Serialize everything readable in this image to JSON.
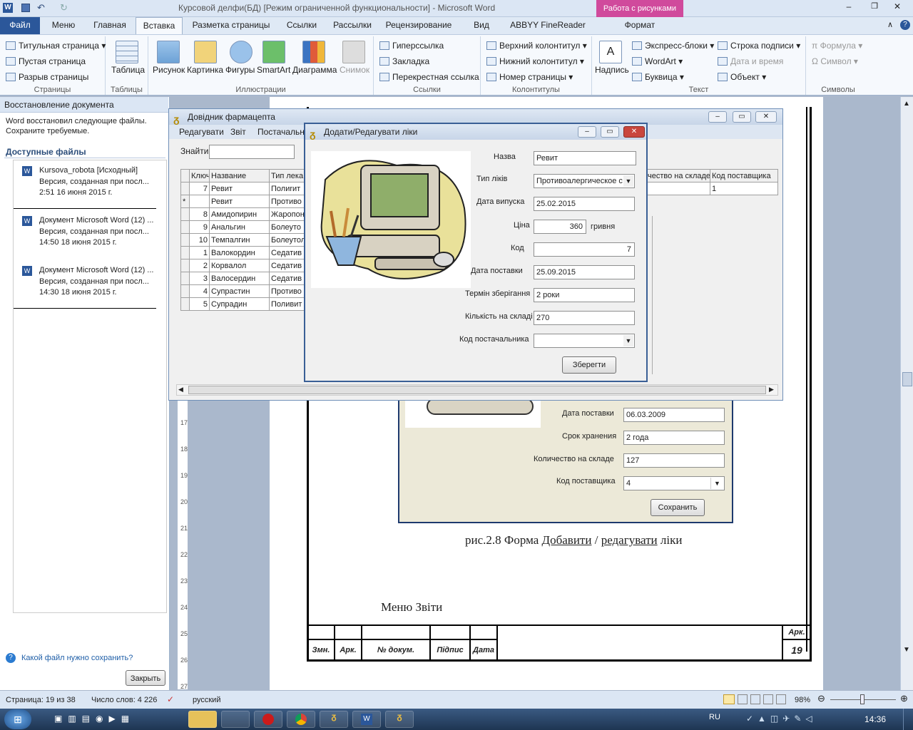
{
  "window": {
    "title": "Курсовой делфи(БД) [Режим ограниченной функциональности] - Microsoft Word",
    "tools_tab": "Работа с рисунками"
  },
  "tabs": [
    "Файл",
    "Меню",
    "Главная",
    "Вставка",
    "Разметка страницы",
    "Ссылки",
    "Рассылки",
    "Рецензирование",
    "Вид",
    "ABBYY FineReader 11",
    "Формат"
  ],
  "ribbon": {
    "pages": {
      "items": [
        "Титульная страница",
        "Пустая страница",
        "Разрыв страницы"
      ],
      "label": "Страницы"
    },
    "tables": {
      "items": [
        "Таблица"
      ],
      "label": "Таблицы"
    },
    "illustrations": {
      "items": [
        "Рисунок",
        "Картинка",
        "Фигуры",
        "SmartArt",
        "Диаграмма",
        "Снимок"
      ],
      "label": "Иллюстрации"
    },
    "links": {
      "items": [
        "Гиперссылка",
        "Закладка",
        "Перекрестная ссылка"
      ],
      "label": "Ссылки"
    },
    "headers": {
      "items": [
        "Верхний колонтитул",
        "Нижний колонтитул",
        "Номер страницы"
      ],
      "label": "Колонтитулы"
    },
    "text": {
      "items": [
        "Надпись",
        "Экспресс-блоки",
        "WordArt",
        "Буквица",
        "Строка подписи",
        "Дата и время",
        "Объект"
      ],
      "label": "Текст"
    },
    "symbols": {
      "items": [
        "Формула",
        "Символ"
      ],
      "label": "Символы"
    }
  },
  "recovery": {
    "header": "Восстановление документа",
    "desc1": "Word восстановил следующие файлы.",
    "desc2": "Сохраните требуемые.",
    "available": "Доступные файлы",
    "files": [
      {
        "name": "Kursova_robota  [Исходный]",
        "desc": "Версия, созданная при посл...",
        "time": "2:51 16 июня 2015 г."
      },
      {
        "name": "Документ Microsoft Word (12) ...",
        "desc": "Версия, созданная при посл...",
        "time": "14:50 18 июня 2015 г."
      },
      {
        "name": "Документ Microsoft Word (12) ...",
        "desc": "Версия, созданная при посл...",
        "time": "14:30 18 июня 2015 г."
      }
    ],
    "help": "Какой файл нужно сохранить?",
    "close": "Закрыть"
  },
  "doc": {
    "f_date_label": "Дата поставки",
    "f_date": "06.03.2009",
    "f_term_label": "Срок хранения",
    "f_term": "2 года",
    "f_qty_label": "Количество на складе",
    "f_qty": "127",
    "f_sup_label": "Код поставщика",
    "f_sup": "4",
    "f_save": "Сохранить",
    "caption_pre": "рис.2.8 Форма ",
    "caption_a": "Добавити",
    "caption_mid": " / ",
    "caption_b": "редагувати",
    "caption_post": " ліки",
    "menu_text": "Меню Звіти",
    "stamp": {
      "h1": "Змн.",
      "h2": "Арк.",
      "h3": "№ докум.",
      "h4": "Підпис",
      "h5": "Дата",
      "ark": "Арк.",
      "num": "19"
    },
    "ruler": [
      "17",
      "18",
      "19",
      "20",
      "21",
      "22",
      "23",
      "24",
      "25",
      "26",
      "27"
    ]
  },
  "app": {
    "title": "Довідник фармацепта",
    "menu": [
      "Редагувати",
      "Звіт",
      "Постачальн"
    ],
    "search_label": "Знайти",
    "columns": [
      "Ключ",
      "Название",
      "Тип лека"
    ],
    "right_cols": [
      "чество на складе",
      "Код поставщика"
    ],
    "rows": [
      [
        "7",
        "Ревит",
        "Полиrит"
      ],
      [
        "*",
        "Ревит",
        "Противо"
      ],
      [
        "8",
        "Амидопирин",
        "Жаропон"
      ],
      [
        "9",
        "Анальгин",
        "Болеуто"
      ],
      [
        "10",
        "Темпалгин",
        "Болеутол"
      ],
      [
        "1",
        "Валокордин",
        "Седатив"
      ],
      [
        "2",
        "Корвалол",
        "Седатив"
      ],
      [
        "3",
        "Валосердин",
        "Седатив"
      ],
      [
        "4",
        "Супрастин",
        "Противо"
      ],
      [
        "5",
        "Супрадин",
        "Поливит"
      ]
    ],
    "right_first": [
      "",
      "1"
    ]
  },
  "dialog": {
    "title": "Додати/Редагувати ліки",
    "name_label": "Назва",
    "name": "Ревит",
    "type_label": "Тип ліків",
    "type": "Противоалергическое с",
    "date_label": "Дата випуска",
    "date": "25.02.2015",
    "price_label": "Ціна",
    "price": "360",
    "price_unit": "гривня",
    "code_label": "Код",
    "code": "7",
    "delivery_label": "Дата поставки",
    "delivery": "25.09.2015",
    "term_label": "Термін зберігання",
    "term": "2 роки",
    "qty_label": "Кількість на складі",
    "qty": "270",
    "sup_label": "Код постачальника",
    "sup": "",
    "save": "Зберегти"
  },
  "status": {
    "page": "Страница: 19 из 38",
    "words": "Число слов: 4 226",
    "lang": "русский",
    "zoom": "98%"
  },
  "taskbar": {
    "lang": "RU",
    "time": "14:36"
  },
  "colors": {
    "accent": "#2b579a",
    "tools_tab": "#d04a9c",
    "selection": "#3399ff"
  }
}
